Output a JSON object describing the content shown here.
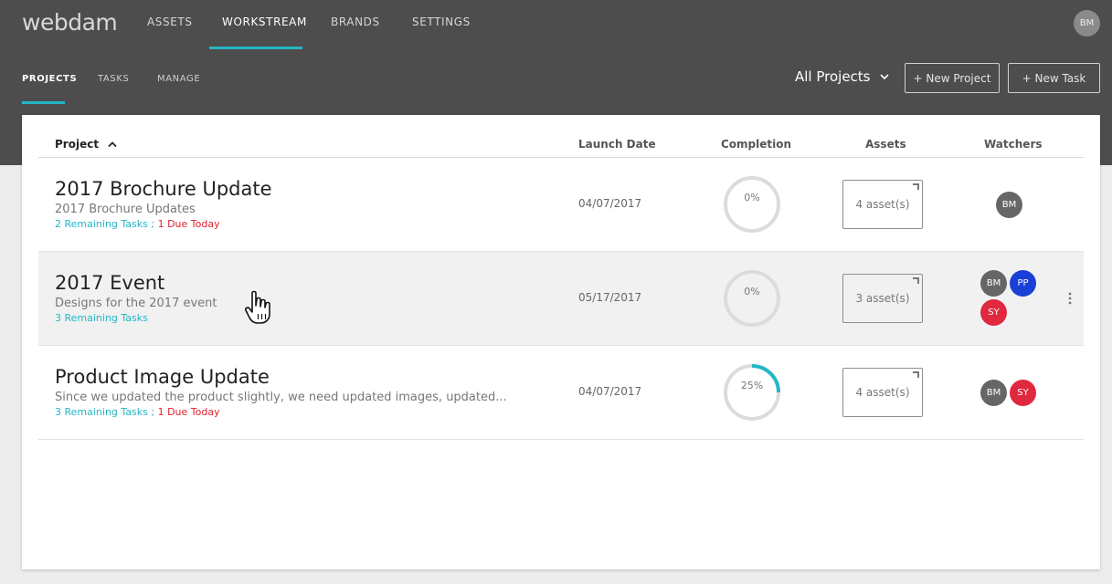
{
  "app": {
    "logo": "webdam"
  },
  "main_nav": [
    {
      "label": "ASSETS"
    },
    {
      "label": "WORKSTREAM",
      "active": true
    },
    {
      "label": "BRANDS"
    },
    {
      "label": "SETTINGS"
    }
  ],
  "user": {
    "initials": "BM"
  },
  "sub_nav": [
    {
      "label": "PROJECTS",
      "active": true
    },
    {
      "label": "TASKS"
    },
    {
      "label": "MANAGE"
    }
  ],
  "filter": {
    "label": "All Projects"
  },
  "actions": {
    "new_project": "+ New Project",
    "new_task": "+ New Task"
  },
  "table": {
    "headers": {
      "project": "Project",
      "launch_date": "Launch Date",
      "completion": "Completion",
      "assets": "Assets",
      "watchers": "Watchers"
    },
    "rows": [
      {
        "title": "2017 Brochure Update",
        "description": "2017 Brochure Updates",
        "remaining": "2 Remaining Tasks ;",
        "due": "1 Due Today",
        "launch_date": "04/07/2017",
        "completion": 0,
        "completion_label": "0%",
        "assets": "4 asset(s)",
        "watchers": [
          {
            "initials": "BM",
            "color": "#666666"
          }
        ]
      },
      {
        "title": "2017 Event",
        "description": "Designs for the 2017 event",
        "remaining": "3 Remaining Tasks",
        "due": "",
        "launch_date": "05/17/2017",
        "completion": 0,
        "completion_label": "0%",
        "assets": "3 asset(s)",
        "watchers": [
          {
            "initials": "BM",
            "color": "#666666"
          },
          {
            "initials": "PP",
            "color": "#1a3fd6"
          },
          {
            "initials": "SY",
            "color": "#e0283f"
          }
        ]
      },
      {
        "title": "Product Image Update",
        "description": "Since we updated the product slightly, we need updated images, updated...",
        "remaining": "3 Remaining Tasks ;",
        "due": "1 Due Today",
        "launch_date": "04/07/2017",
        "completion": 25,
        "completion_label": "25%",
        "assets": "4 asset(s)",
        "watchers": [
          {
            "initials": "BM",
            "color": "#666666"
          },
          {
            "initials": "SY",
            "color": "#e0283f"
          }
        ]
      }
    ]
  },
  "colors": {
    "accent": "#25b6c6",
    "due": "#e0202e",
    "topbar": "#4d4d4d"
  }
}
